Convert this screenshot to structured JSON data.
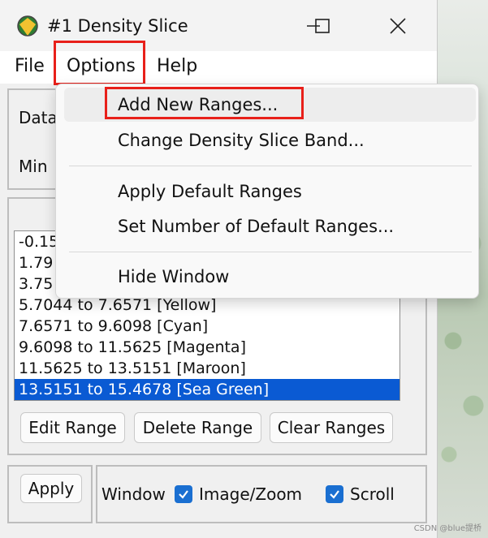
{
  "window": {
    "title": "#1 Density Slice",
    "controls": {
      "minimize": "—",
      "maximize": "☐",
      "close": "✕"
    }
  },
  "menubar": {
    "file": "File",
    "options": "Options",
    "help": "Help"
  },
  "panel": {
    "data_label": "Data",
    "min_label": "Min"
  },
  "ranges_list": {
    "rows": [
      "-0.15",
      "1.79",
      "3.75",
      "5.7044 to 7.6571 [Yellow]",
      "7.6571 to 9.6098 [Cyan]",
      "9.6098 to 11.5625 [Magenta]",
      "11.5625 to 13.5151 [Maroon]",
      "13.5151 to 15.4678 [Sea Green]"
    ],
    "selected_index": 7
  },
  "buttons": {
    "edit_range": "Edit Range",
    "delete_range": "Delete Range",
    "clear_ranges": "Clear Ranges",
    "apply": "Apply"
  },
  "window_options": {
    "label": "Window",
    "image_zoom": {
      "label": "Image/Zoom",
      "checked": true
    },
    "scroll": {
      "label": "Scroll",
      "checked": true
    }
  },
  "options_menu": {
    "items": [
      "Add New Ranges...",
      "Change Density Slice Band...",
      "Apply Default Ranges",
      "Set Number of Default Ranges...",
      "Hide Window"
    ],
    "hovered_index": 0
  },
  "colors": {
    "highlight_box": "#e8201a",
    "selection": "#0a5ad3",
    "checkbox": "#1a6fd1"
  },
  "watermark": "CSDN @blue提桥"
}
